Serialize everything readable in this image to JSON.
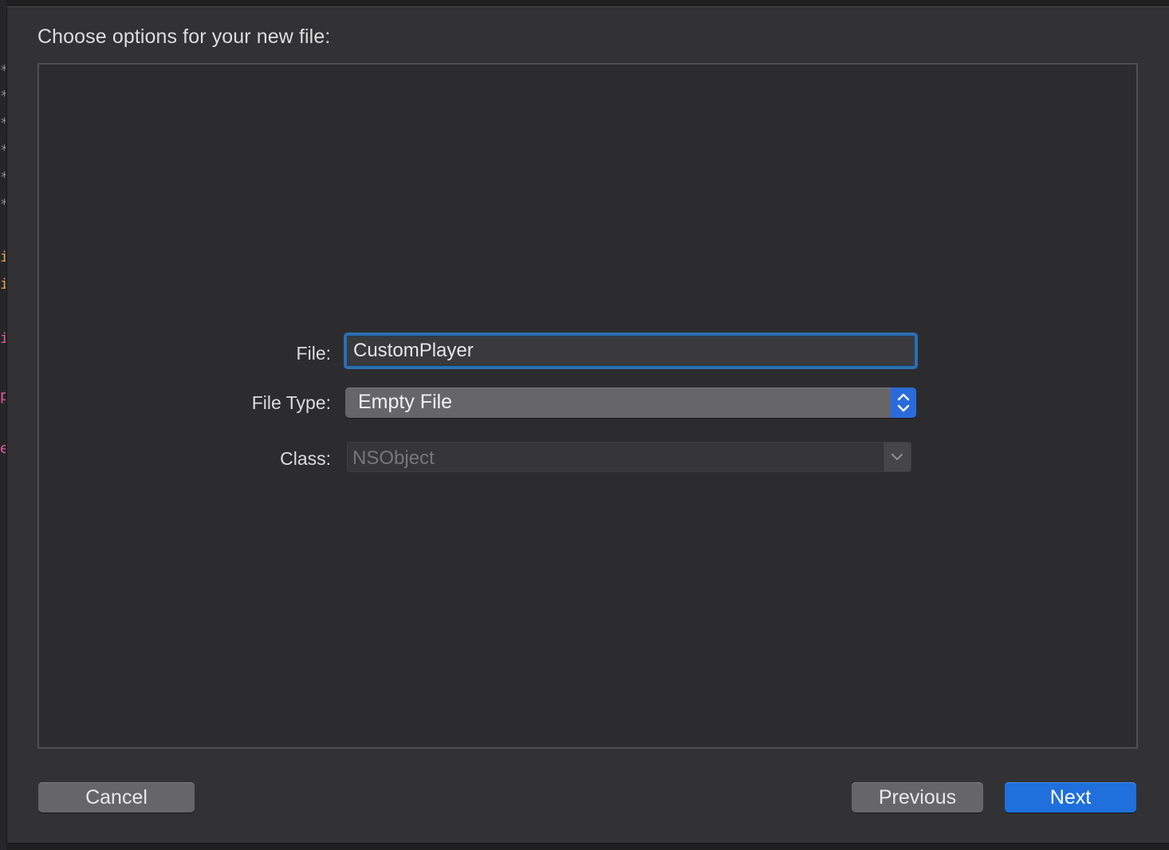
{
  "dialog": {
    "title": "Choose options for your new file:"
  },
  "form": {
    "file": {
      "label": "File:",
      "value": "CustomPlayer"
    },
    "file_type": {
      "label": "File Type:",
      "selected": "Empty File"
    },
    "class": {
      "label": "Class:",
      "value": "NSObject",
      "enabled": false
    }
  },
  "buttons": {
    "cancel": "Cancel",
    "previous": "Previous",
    "next": "Next"
  },
  "colors": {
    "accent": "#1f6fdc",
    "focus_ring": "#2c6fb0",
    "sheet_bg": "#323234",
    "pane_bg": "#2c2c2e"
  },
  "icons": {
    "popup_stepper": "up-down-chevron-icon",
    "class_dropdown": "chevron-down-icon"
  }
}
